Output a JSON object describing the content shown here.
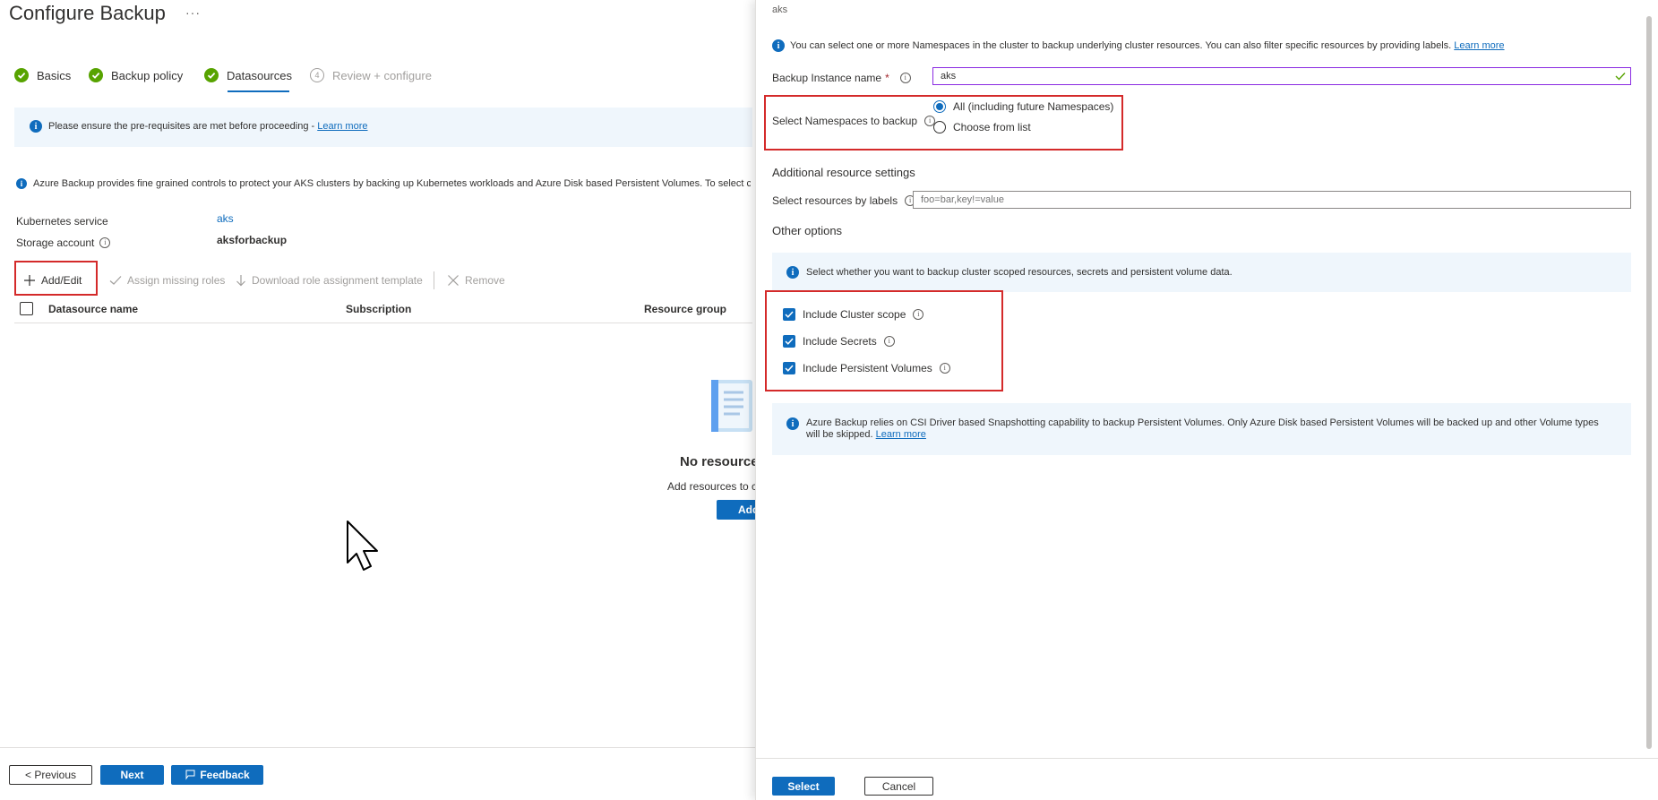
{
  "page": {
    "title": "Configure Backup",
    "more": "···"
  },
  "wizard": {
    "steps": [
      {
        "label": "Basics",
        "state": "complete"
      },
      {
        "label": "Backup policy",
        "state": "complete"
      },
      {
        "label": "Datasources",
        "state": "current"
      },
      {
        "label": "Review + configure",
        "number": "4",
        "state": "pending"
      }
    ]
  },
  "prereq": {
    "text": "Please ensure the pre-requisites are met before proceeding - ",
    "link": "Learn more"
  },
  "description": "Azure Backup provides fine grained controls to protect your AKS clusters by backing up Kubernetes workloads and Azure Disk based Persistent Volumes. To select cluster",
  "details": {
    "k8s_label": "Kubernetes service",
    "k8s_value": "aks",
    "storage_label": "Storage account",
    "storage_value": "aksforbackup"
  },
  "toolbar": {
    "add_edit": "Add/Edit",
    "assign_roles": "Assign missing roles",
    "download_template": "Download role assignment template",
    "remove": "Remove"
  },
  "table": {
    "columns": [
      "Datasource name",
      "Subscription",
      "Resource group"
    ]
  },
  "empty_state": {
    "title": "No resources",
    "subtitle": "Add resources to c",
    "button": "Add"
  },
  "footer": {
    "previous": "< Previous",
    "next": "Next",
    "feedback": "Feedback"
  },
  "panel": {
    "subtitle": "aks",
    "info_text": "You can select one or more Namespaces in the cluster to backup underlying cluster resources. You can also filter specific resources by providing labels. ",
    "info_link": "Learn more",
    "instance_label": "Backup Instance name",
    "required_mark": "*",
    "instance_value": "aks",
    "namespaces_label": "Select Namespaces to backup",
    "ns_option_all": "All (including future Namespaces)",
    "ns_option_list": "Choose from list",
    "ns_selected": "all",
    "additional_heading": "Additional resource settings",
    "labels_label": "Select resources by labels",
    "labels_placeholder": "foo=bar,key!=value",
    "other_heading": "Other options",
    "options_info": "Select whether you want to backup cluster scoped resources, secrets and persistent volume data.",
    "options": [
      {
        "label": "Include Cluster scope",
        "checked": true
      },
      {
        "label": "Include Secrets",
        "checked": true
      },
      {
        "label": "Include Persistent Volumes",
        "checked": true
      }
    ],
    "csi_info": "Azure Backup relies on CSI Driver based Snapshotting capability to backup Persistent Volumes. Only Azure Disk based Persistent Volumes will be backed up and other Volume types will be skipped. ",
    "csi_link": "Learn more",
    "select_button": "Select",
    "cancel_button": "Cancel"
  },
  "colors": {
    "accent": "#0f6cbd",
    "success": "#57a300",
    "highlight": "#d42a2a",
    "info_bg": "#eff6fc"
  }
}
